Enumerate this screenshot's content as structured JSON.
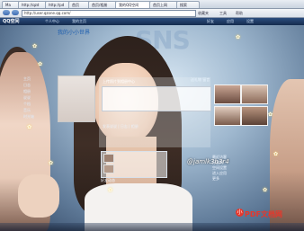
{
  "browser": {
    "tabs": [
      {
        "label": "Ma",
        "active": false
      },
      {
        "label": "http://qzd",
        "active": false
      },
      {
        "label": "http://pd",
        "active": false
      },
      {
        "label": "首页",
        "active": false
      },
      {
        "label": "首页/相册",
        "active": false
      },
      {
        "label": "我的QQ空间",
        "active": true
      },
      {
        "label": "首页上网",
        "active": false
      },
      {
        "label": "搜索",
        "active": false
      }
    ],
    "address": "http://user.qzone.qq.com/",
    "bookmarks": [
      "收藏夹",
      "工具",
      "帮助"
    ]
  },
  "qzone_bar": {
    "logo": "QQ空间",
    "links": [
      "个人中心",
      "我的主页",
      "好友",
      "应用",
      "设置"
    ]
  },
  "space": {
    "title": "我的小小世界",
    "banner_text": "SNS",
    "panel_title": "上传照片到相册中心",
    "panel_row": "发表说说 | 日志 | 相册",
    "right_links": "送礼物 留言",
    "sidebar_items": [
      "主页",
      "日志",
      "相册",
      "说说",
      "个档",
      "音乐",
      "时光轴"
    ],
    "feed_row": "好友动态",
    "signature": "@jamlk3b3r4",
    "right_list": [
      "最近访客",
      "好友网",
      "空间设置",
      "进入应用",
      "更多"
    ]
  },
  "watermark": {
    "icon": "小",
    "text": "PDF文档网"
  }
}
